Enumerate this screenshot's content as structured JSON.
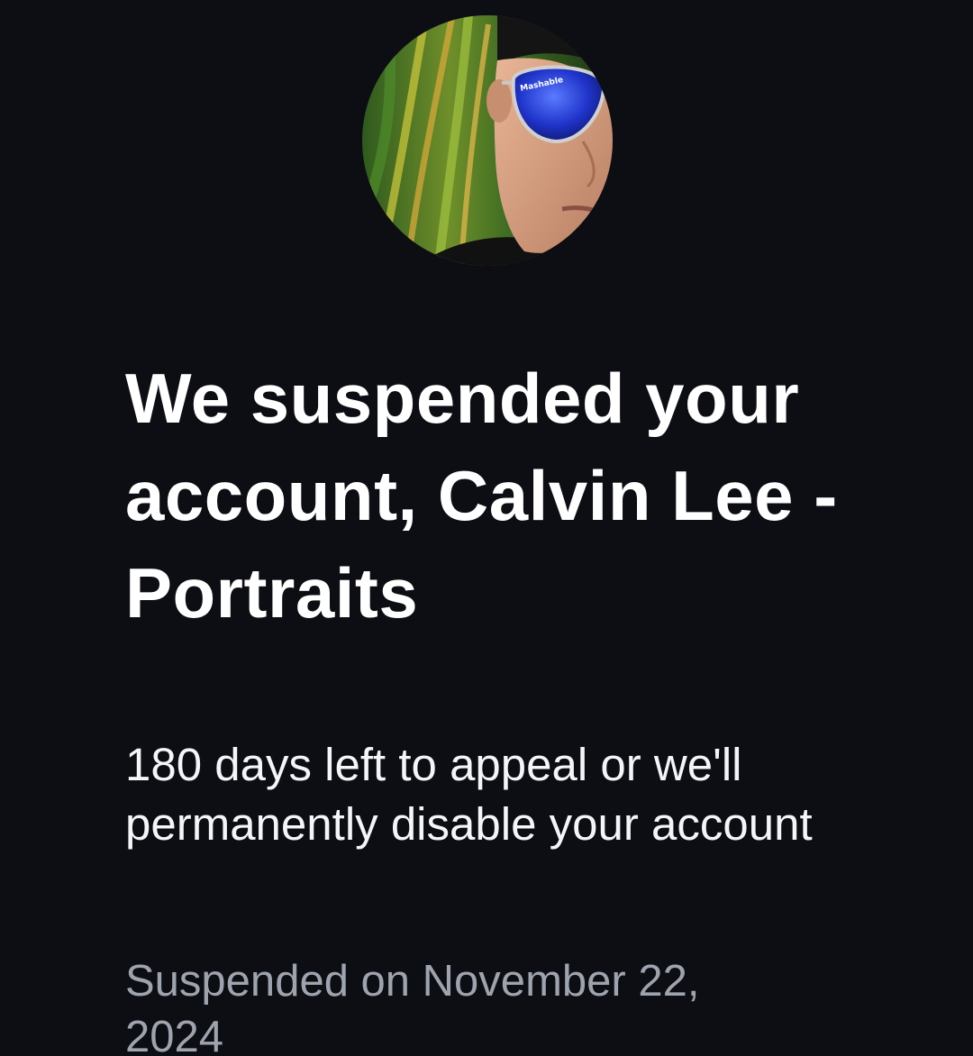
{
  "profile": {
    "avatar_icon": "profile-photo",
    "sunglasses_text": "Mashable"
  },
  "suspension": {
    "title": "We suspended your account, Calvin Lee - Portraits",
    "appeal_notice": "180 days left to appeal or we'll permanently disable your account",
    "suspended_on": "Suspended on November 22, 2024"
  },
  "colors": {
    "background": "#0c0e14",
    "title_text": "#ffffff",
    "body_text": "#f4f5f7",
    "muted_text": "#9ea3ad"
  }
}
